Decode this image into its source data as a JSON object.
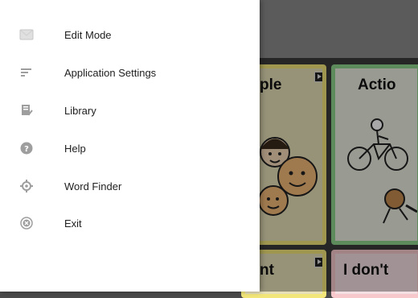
{
  "drawer": {
    "items": [
      {
        "label": "Edit Mode",
        "icon": "edit-mode-icon"
      },
      {
        "label": "Application Settings",
        "icon": "settings-icon"
      },
      {
        "label": "Library",
        "icon": "library-icon"
      },
      {
        "label": "Help",
        "icon": "help-icon"
      },
      {
        "label": "Word Finder",
        "icon": "word-finder-icon"
      },
      {
        "label": "Exit",
        "icon": "exit-icon"
      }
    ]
  },
  "grid": {
    "tiles": [
      {
        "label": "ple",
        "color": "#f2e67a"
      },
      {
        "label": "Actio",
        "color": "#8fd48c"
      },
      {
        "label": "nt",
        "color": "#f2e67a"
      },
      {
        "label": "I don't",
        "color": "#f7c8cc"
      }
    ]
  },
  "colors": {
    "drawer_bg": "#ffffff",
    "icon_gray": "#9e9e9e",
    "text": "#212121"
  }
}
